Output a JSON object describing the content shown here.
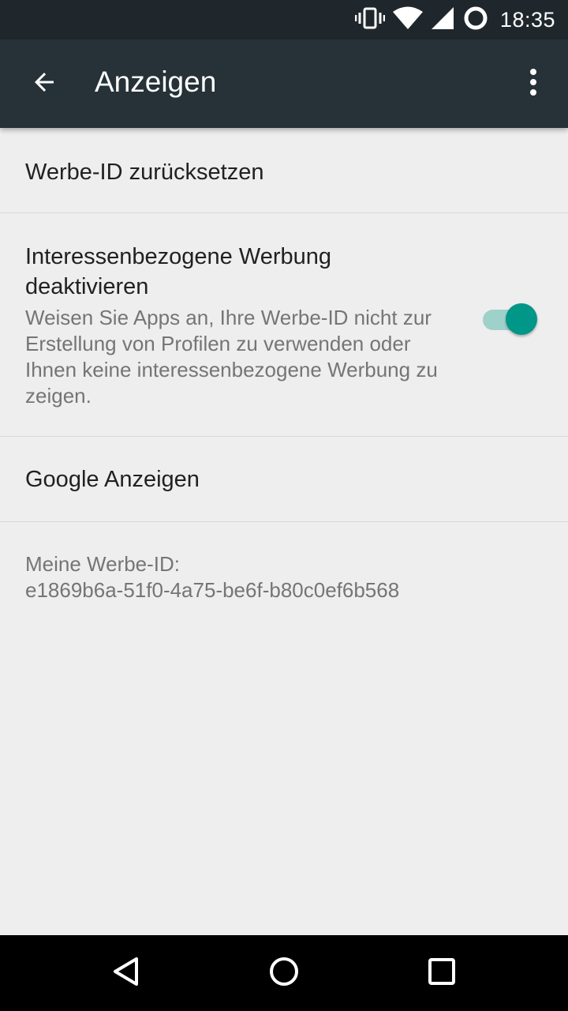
{
  "status_bar": {
    "time": "18:35",
    "icons": [
      "vibrate-icon",
      "wifi-icon",
      "cell-signal-icon",
      "sync-circle-icon"
    ]
  },
  "toolbar": {
    "title": "Anzeigen",
    "back_icon": "arrow-back-icon",
    "overflow_icon": "more-vert-icon"
  },
  "settings": {
    "reset_id": {
      "title": "Werbe-ID zurücksetzen"
    },
    "interest_ads": {
      "title": "Interessenbezogene Werbung deaktivieren",
      "summary": "Weisen Sie Apps an, Ihre Werbe-ID nicht zur Erstellung von Profilen zu verwenden oder Ihnen keine interessenbezogene Werbung zu zeigen.",
      "enabled": true
    },
    "google_ads": {
      "title": "Google Anzeigen"
    },
    "ad_id": {
      "label": "Meine Werbe-ID:",
      "value": "e1869b6a-51f0-4a75-be6f-b80c0ef6b568"
    }
  },
  "nav_bar": {
    "back_icon": "nav-back-icon",
    "home_icon": "nav-home-icon",
    "recents_icon": "nav-recents-icon"
  },
  "colors": {
    "toolbar": "#263238",
    "status_bar": "#1f272c",
    "accent": "#009688",
    "background": "#eeeeee"
  }
}
